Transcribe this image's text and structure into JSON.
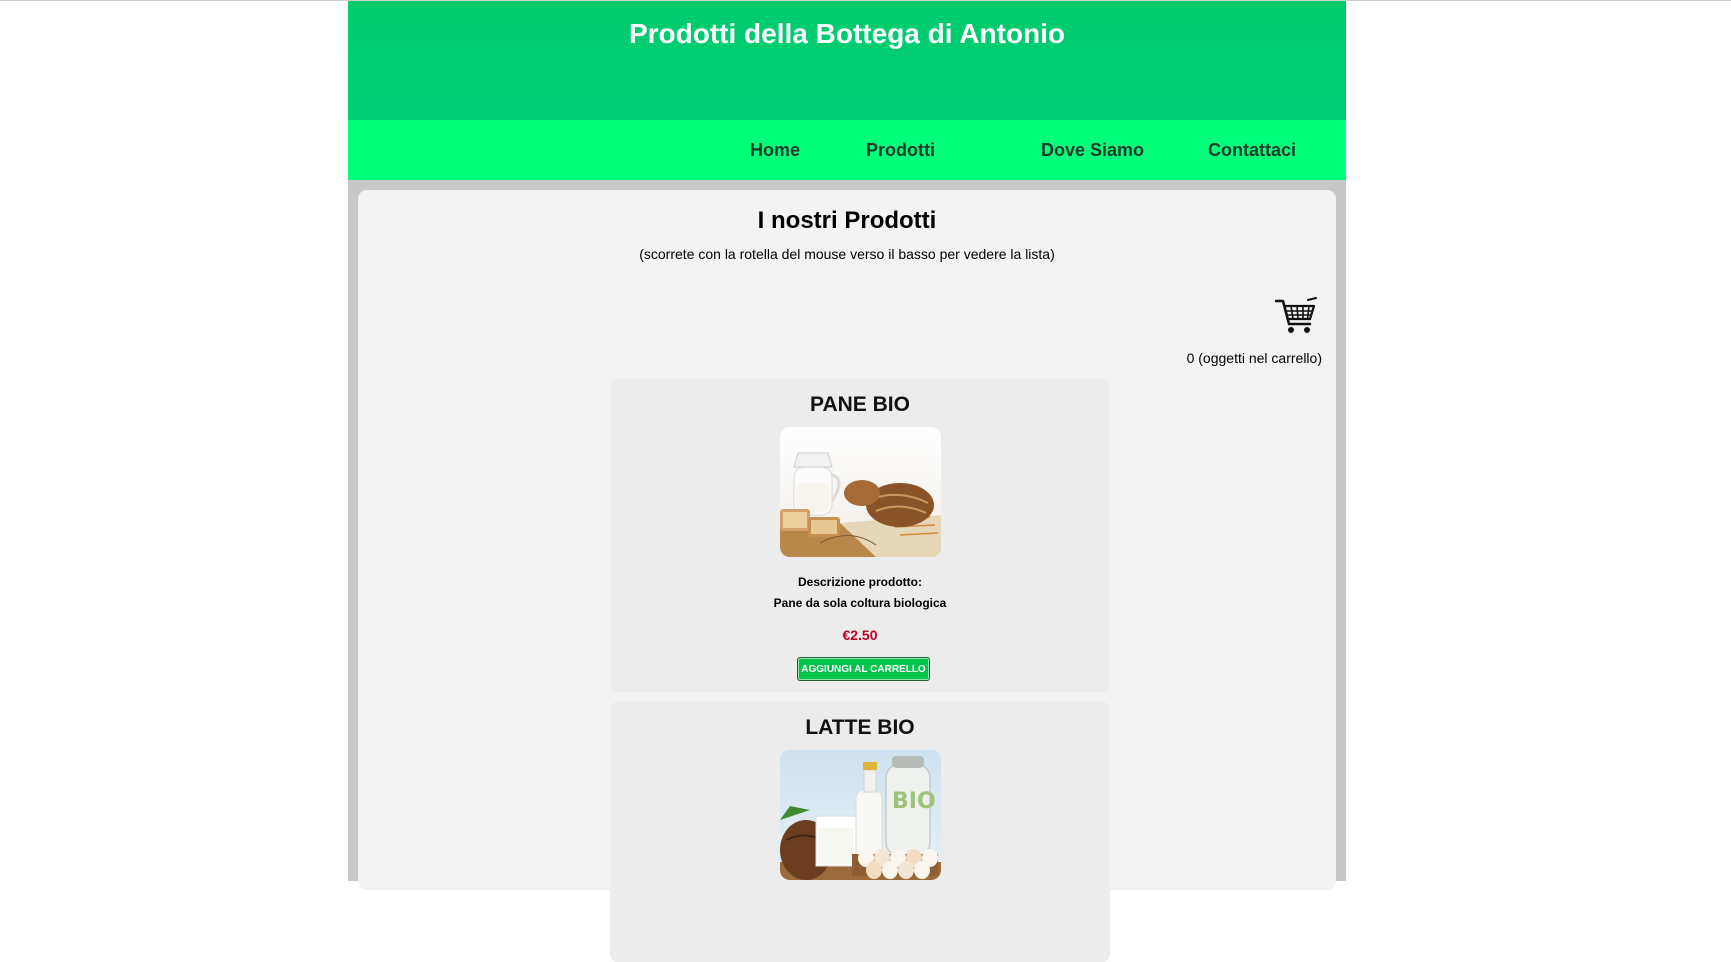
{
  "site": {
    "title": "Prodotti della Bottega di Antonio",
    "brand_color": "#00cc70",
    "nav_color": "#00ff7a"
  },
  "nav": {
    "items": [
      {
        "label": "Home"
      },
      {
        "label": "Prodotti"
      },
      {
        "label": "Dove Siamo"
      },
      {
        "label": "Contattaci"
      }
    ]
  },
  "page": {
    "heading": "I nostri Prodotti",
    "subtitle": "(scorrete con la rotella del mouse verso il basso per vedere la lista)"
  },
  "cart": {
    "icon": "shopping-cart-icon",
    "count_text": "0 (oggetti nel carrello)"
  },
  "products": [
    {
      "name": "PANE BIO",
      "image": "bread-and-milk-photo",
      "desc_label": "Descrizione prodotto:",
      "description": "Pane da sola coltura biologica",
      "price": "€2.50",
      "button_label": "AGGIUNGI AL CARRELLO"
    },
    {
      "name": "LATTE BIO",
      "image": "organic-milk-and-eggs-photo"
    }
  ],
  "colors": {
    "price": "#c00020",
    "button": "#00c54d"
  }
}
